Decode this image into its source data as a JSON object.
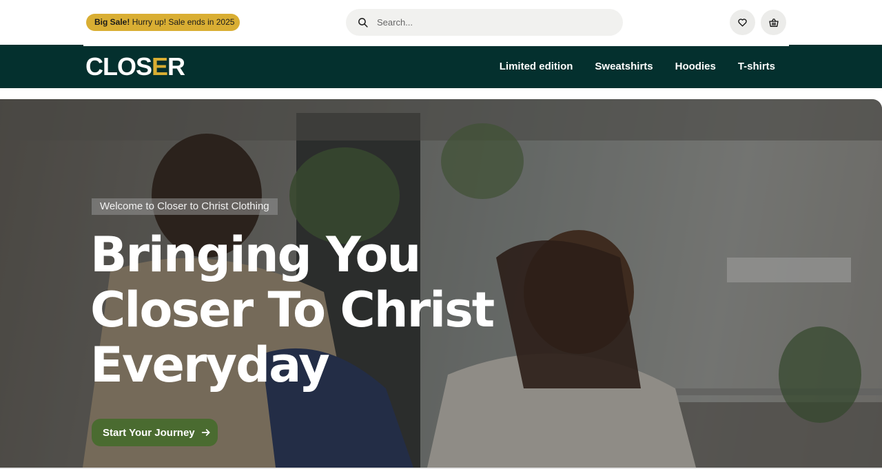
{
  "topbar": {
    "sale_bold": "Big Sale!",
    "sale_text": " Hurry up! Sale ends in 2025",
    "search_placeholder": "Search..."
  },
  "icons": {
    "search": "search-icon",
    "wishlist": "heart-icon",
    "cart": "basket-icon",
    "cta_arrow": "arrow-right-icon"
  },
  "navbar": {
    "logo_part1": "CLOS",
    "logo_part2": "E",
    "logo_part3": "R",
    "links": [
      "Limited edition",
      "Sweatshirts",
      "Hoodies",
      "T-shirts"
    ]
  },
  "hero": {
    "welcome": "Welcome to Closer to Christ Clothing",
    "headline_line1": "Bringing You",
    "headline_line2": "Closer To Christ",
    "headline_line3": "Everyday",
    "cta_label": "Start Your Journey"
  },
  "colors": {
    "brand_dark": "#04302e",
    "accent_gold": "#d9ae33",
    "cta_green": "#4a6b30"
  }
}
